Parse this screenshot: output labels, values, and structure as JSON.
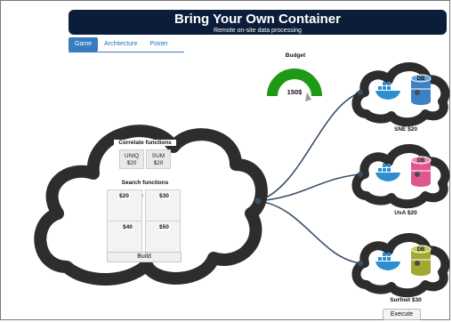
{
  "header": {
    "title": "Bring Your Own Container",
    "subtitle": "Remote on-site data processing"
  },
  "tabs": [
    {
      "label": "Game"
    },
    {
      "label": "Architecture"
    },
    {
      "label": "Poster"
    }
  ],
  "budget": {
    "label": "Budget",
    "value": "150$"
  },
  "main_cloud": {
    "correlate_label": "Correlate functions",
    "correlate": [
      {
        "name": "UNIQ",
        "price": "$20"
      },
      {
        "name": "SUM",
        "price": "$20"
      }
    ],
    "search_label": "Search functions",
    "search_prices": [
      "$20",
      "$30",
      "$40",
      "$50"
    ],
    "build_label": "Build"
  },
  "providers": [
    {
      "label": "SNE $20",
      "db": "DB",
      "db_color": "#3b82c4"
    },
    {
      "label": "UvA $20",
      "db": "DB",
      "db_color": "#e0568f"
    },
    {
      "label": "Surfnet $30",
      "db": "DB",
      "db_color": "#a3a830"
    }
  ],
  "execute_label": "Execute",
  "colors": {
    "banner": "#0c1d3a",
    "tab_active": "#3a7cc2",
    "gauge": "#1f9a16",
    "docker": "#2d8fd0",
    "links": "#3a5068"
  }
}
